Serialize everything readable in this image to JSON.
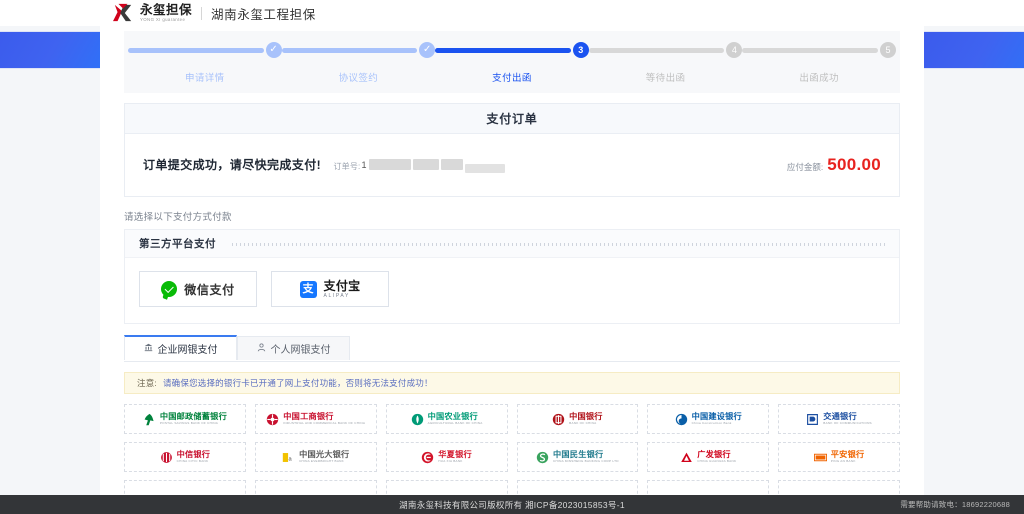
{
  "header": {
    "logo_name": "yongxi-logo",
    "brand_cn": "永玺担保",
    "brand_en": "YONG XI guarantee",
    "brand_sub": "湖南永玺工程担保"
  },
  "steps": [
    {
      "index": "1",
      "label": "申请详情",
      "state": "done"
    },
    {
      "index": "2",
      "label": "协议签约",
      "state": "done"
    },
    {
      "index": "3",
      "label": "支付出函",
      "state": "active"
    },
    {
      "index": "4",
      "label": "等待出函",
      "state": "todo"
    },
    {
      "index": "5",
      "label": "出函成功",
      "state": "todo"
    }
  ],
  "order": {
    "title": "支付订单",
    "message": "订单提交成功，请尽快完成支付!",
    "order_no_label": "订单号:",
    "order_no_value": "1",
    "amount_label": "应付金额:",
    "amount_value": "500.00",
    "amount_color": "#e8231f"
  },
  "choose_hint": "请选择以下支付方式付款",
  "third_party": {
    "title": "第三方平台支付",
    "methods": [
      {
        "name": "wechat-pay",
        "label": "微信支付",
        "color": "#09bb07"
      },
      {
        "name": "alipay",
        "label": "支付宝",
        "sub": "ALIPAY",
        "color": "#1677ff"
      }
    ]
  },
  "tabs": [
    {
      "label": "企业网银支付",
      "icon": "bank-icon",
      "active": true
    },
    {
      "label": "个人网银支付",
      "icon": "person-icon",
      "active": false
    }
  ],
  "notice": {
    "label": "注意:",
    "text": "请确保您选择的银行卡已开通了网上支付功能，否则将无法支付成功！"
  },
  "banks": [
    {
      "cn": "中国邮政储蓄银行",
      "en": "POSTAL SAVINGS BANK OF CHINA",
      "color": "#00823c",
      "logo": "psbc-logo"
    },
    {
      "cn": "中国工商银行",
      "en": "INDUSTRIAL AND COMMERCIAL BANK OF CHINA",
      "color": "#c8102e",
      "logo": "icbc-logo"
    },
    {
      "cn": "中国农业银行",
      "en": "AGRICULTURAL BANK OF CHINA",
      "color": "#009b77",
      "logo": "abc-logo"
    },
    {
      "cn": "中国银行",
      "en": "BANK OF CHINA",
      "color": "#b01118",
      "logo": "boc-logo"
    },
    {
      "cn": "中国建设银行",
      "en": "China Construction Bank",
      "color": "#0a5fa8",
      "logo": "ccb-logo"
    },
    {
      "cn": "交通银行",
      "en": "BANK OF COMMUNICATIONS",
      "color": "#1c4fa1",
      "logo": "bocom-logo"
    },
    {
      "cn": "中信银行",
      "en": "CHINA CITIC BANK",
      "color": "#c8102e",
      "logo": "citic-logo"
    },
    {
      "cn": "中国光大银行",
      "en": "CHINA EVERBRIGHT BANK",
      "color": "#5a5a5a",
      "logo": "ceb-logo"
    },
    {
      "cn": "华夏银行",
      "en": "HUA XIA BANK",
      "color": "#d3142a",
      "logo": "hxb-logo"
    },
    {
      "cn": "中国民生银行",
      "en": "CHINA MINSHENG BANKING CORP LTD",
      "color": "#1f7a8c",
      "logo": "cmbc-logo"
    },
    {
      "cn": "广发银行",
      "en": "CHINA GUANGFA BANK",
      "color": "#d0021b",
      "logo": "cgb-logo"
    },
    {
      "cn": "平安银行",
      "en": "PING AN BANK",
      "color": "#f06400",
      "logo": "pingan-logo"
    },
    {
      "cn": "",
      "en": "",
      "color": "#ffffff",
      "logo": "bank-row3-a"
    },
    {
      "cn": "",
      "en": "",
      "color": "#ffffff",
      "logo": "bank-row3-b"
    },
    {
      "cn": "",
      "en": "",
      "color": "#ffffff",
      "logo": "bank-row3-c"
    },
    {
      "cn": "",
      "en": "",
      "color": "#ffffff",
      "logo": "bank-row3-d"
    },
    {
      "cn": "",
      "en": "",
      "color": "#ffffff",
      "logo": "bank-row3-e"
    },
    {
      "cn": "",
      "en": "",
      "color": "#ffffff",
      "logo": "bank-row3-f"
    }
  ],
  "footer": {
    "copyright": "湖南永玺科技有限公司版权所有 湘ICP备2023015853号-1",
    "help": "需要帮助请致电：18692220688"
  }
}
